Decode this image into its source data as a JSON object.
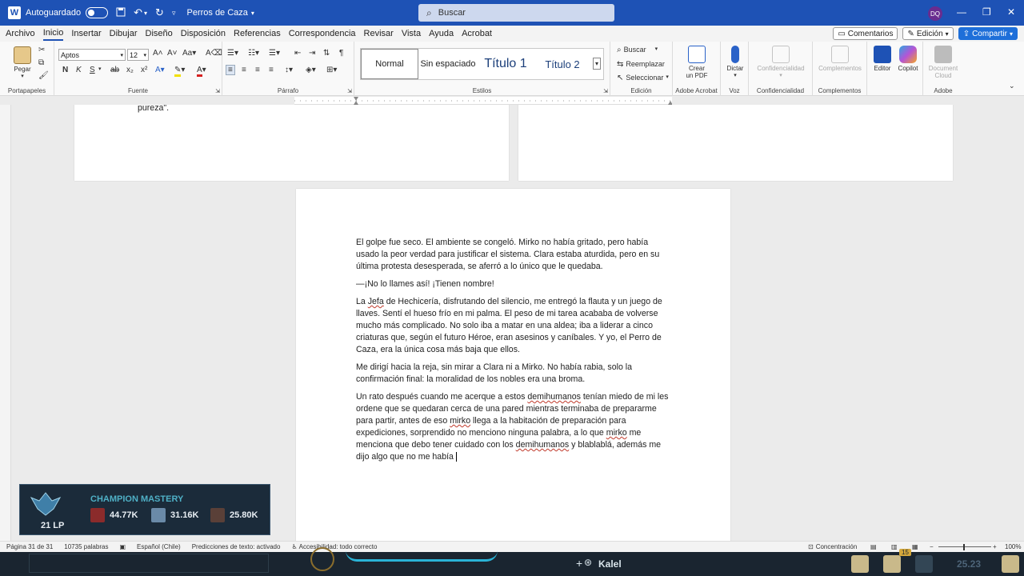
{
  "titlebar": {
    "autosave_label": "Autoguardado",
    "doc_title": "Perros de Caza",
    "search_placeholder": "Buscar",
    "avatar_initials": "DQ"
  },
  "menu": {
    "tabs": [
      "Archivo",
      "Inicio",
      "Insertar",
      "Dibujar",
      "Diseño",
      "Disposición",
      "Referencias",
      "Correspondencia",
      "Revisar",
      "Vista",
      "Ayuda",
      "Acrobat"
    ],
    "active_tab": "Inicio",
    "comments_label": "Comentarios",
    "edit_label": "Edición",
    "share_label": "Compartir"
  },
  "ribbon": {
    "clipboard": {
      "paste_label": "Pegar",
      "group_label": "Portapapeles"
    },
    "font": {
      "font_name": "Aptos",
      "font_size": "12",
      "group_label": "Fuente"
    },
    "paragraph": {
      "group_label": "Párrafo"
    },
    "styles": {
      "items": [
        "Normal",
        "Sin espaciado",
        "Título 1",
        "Título 2"
      ],
      "group_label": "Estilos"
    },
    "editing": {
      "find": "Buscar",
      "replace": "Reemplazar",
      "select": "Seleccionar",
      "group_label": "Edición"
    },
    "acrobat": {
      "create_pdf_line1": "Crear",
      "create_pdf_line2": "un PDF",
      "group_label": "Adobe Acrobat"
    },
    "voice": {
      "dictate": "Dictar",
      "group_label": "Voz"
    },
    "confidentiality": {
      "btn": "Confidencialidad",
      "group_label": "Confidencialidad"
    },
    "addins": {
      "btn": "Complementos",
      "group_label": "Complementos"
    },
    "editor": {
      "editor": "Editor",
      "copilot": "Copilot"
    },
    "adobe": {
      "btn_line1": "Document",
      "btn_line2": "Cloud",
      "group_label": "Adobe"
    }
  },
  "prev_page_text": "pureza\".",
  "page": {
    "paragraphs": [
      "El golpe fue seco. El ambiente se congeló. Mirko no había gritado, pero había usado la peor verdad para justificar el sistema. Clara estaba aturdida, pero en su última protesta desesperada, se aferró a lo único que le quedaba.",
      "—¡No lo llames así! ¡Tienen nombre!",
      "La Jefa de Hechicería, disfrutando del silencio, me entregó la flauta y un juego de llaves. Sentí el hueso frío en mi palma. El peso de mi tarea acababa de volverse mucho más complicado. No solo iba a matar en una aldea; iba a liderar a cinco criaturas que, según el futuro Héroe, eran asesinos y caníbales. Y yo, el Perro de Caza, era la única cosa más baja que ellos.",
      "Me dirigí hacia la reja, sin mirar a Clara ni a Mirko. No había rabia, solo la confirmación final: la moralidad de los nobles era una broma.",
      "Un rato después cuando me acerque a estos demihumanos tenían miedo de mi les ordene que se quedaran cerca de una pared mientras terminaba de prepararme para partir, antes de eso mirko llega a la habitación de preparación para expediciones, sorprendido no menciono ninguna palabra, a lo que mirko me menciona que debo tener cuidado con los demihumanos y blablablá, además me dijo algo que no me había "
    ]
  },
  "mastery": {
    "title": "CHAMPION MASTERY",
    "lp": "21 LP",
    "values": [
      "44.77K",
      "31.16K",
      "25.80K"
    ]
  },
  "status": {
    "page": "Página 31 de 31",
    "words": "10735 palabras",
    "language": "Español (Chile)",
    "predictions": "Predicciones de texto: activado",
    "accessibility": "Accesibilidad: todo correcto",
    "focus": "Concentración",
    "zoom": "100%"
  },
  "taskbar": {
    "kalel": "Kalel",
    "time": "25.23",
    "badge": "15"
  }
}
